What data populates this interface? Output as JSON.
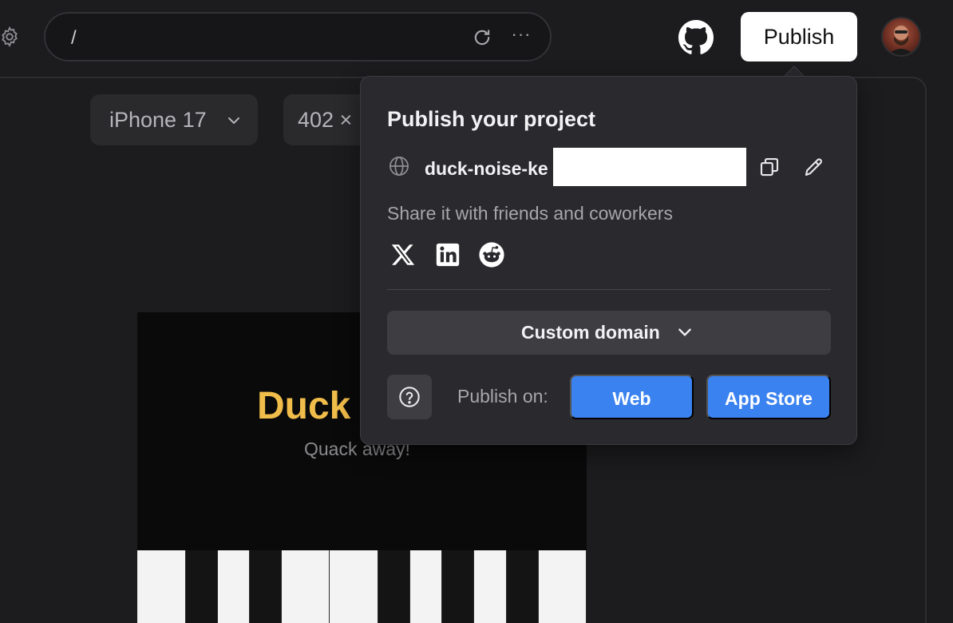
{
  "toolbar": {
    "url_path": "/",
    "more_glyph": "···",
    "publish_label": "Publish"
  },
  "icons": {
    "settings": "gear-icon",
    "refresh": "refresh-icon",
    "more": "more-horizontal-icon",
    "github": "github-icon",
    "avatar": "user-avatar"
  },
  "preview": {
    "device_label": "iPhone 17",
    "size_label": "402 ×",
    "app_title": "Duck",
    "app_subtitle": "Quack away!"
  },
  "popover": {
    "title": "Publish your project",
    "domain": "duck-noise-ke",
    "share_text": "Share it with friends and coworkers",
    "custom_domain_label": "Custom domain",
    "publish_on_label": "Publish on:",
    "web_label": "Web",
    "app_store_label": "App Store"
  },
  "colors": {
    "accent_blue": "#3a82f0",
    "app_title_yellow": "#f1bd4a",
    "background": "#1c1c1e",
    "popover_bg": "#2a2a2e"
  }
}
